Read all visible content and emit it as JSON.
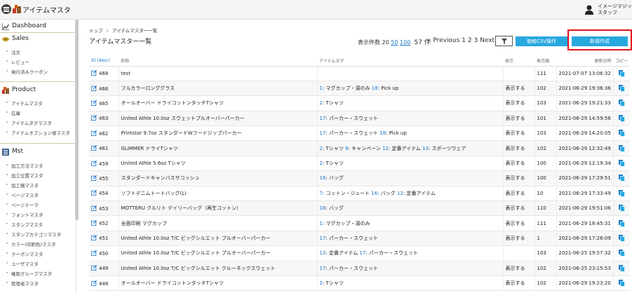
{
  "header": {
    "title": "アイテムマスタ",
    "user_line1": "イメージマジック",
    "user_line2": "スタッフ"
  },
  "sidebar": {
    "dashboard": "Dashboard",
    "sales": "Sales",
    "sales_items": [
      "注文",
      "レビュー",
      "発行済みクーポン"
    ],
    "product": "Product",
    "product_items": [
      "アイテムマスタ",
      "在庫",
      "アイテムタグマスタ",
      "アイテムオプション値マスタ"
    ],
    "mst": "Mst",
    "mst_items": [
      "加工方法マスタ",
      "加工位置マスタ",
      "加工機マスタ",
      "ページマスタ",
      "ページテーマ",
      "フォントマスタ",
      "スタンプマスタ",
      "スタンプカテゴリマスタ",
      "カラー(印刷色)マスタ",
      "クーポンマスタ",
      "ユーザマスタ",
      "権限グループマスタ",
      "管理者マスタ"
    ]
  },
  "breadcrumb": {
    "top": "トップ",
    "sep": ">",
    "current": "アイテムマスター一覧"
  },
  "page_title": "アイテムマスター一覧",
  "pager": {
    "label": "表示件数",
    "opt1": "20",
    "opt2": "50",
    "opt3": "100",
    "total": "57 件",
    "prev": "« Previous",
    "pages": [
      "1",
      "2",
      "3"
    ],
    "next": "Next »"
  },
  "buttons": {
    "csv": "価格CSV操作",
    "new": "新規作成"
  },
  "columns": {
    "id": "ID (desc)",
    "name": "名称",
    "tags": "アイテムタグ",
    "display": "表示",
    "order": "表示順",
    "updated": "更新日時",
    "copy": "コピー"
  },
  "rows": [
    {
      "id": "468",
      "name": "test",
      "tags": "",
      "display": "",
      "order": "111",
      "updated": "2021-07-07 13:06:32"
    },
    {
      "id": "466",
      "name": "フルカラーロンググラス",
      "tags": "1: マグカップ・湯のみ 18: Pick up",
      "display": "表示する",
      "order": "102",
      "updated": "2021-06-29 19:36:36"
    },
    {
      "id": "465",
      "name": "オールオーバー ドライコットンタッチTシャツ",
      "tags": "2: Tシャツ",
      "display": "表示する",
      "order": "103",
      "updated": "2021-06-29 19:21:33"
    },
    {
      "id": "463",
      "name": "United Athle 10.0oz スウェットプルオーバーパーカー",
      "tags": "17: パーカー・スウェット",
      "display": "表示する",
      "order": "101",
      "updated": "2021-06-29 14:59:56"
    },
    {
      "id": "462",
      "name": "Printstar 9.7oz スタンダードWフードジップパーカー",
      "tags": "17: パーカー・スウェット 18: Pick up",
      "display": "表示する",
      "order": "103",
      "updated": "2021-06-29 14:20:05"
    },
    {
      "id": "461",
      "name": "GLIMMER ドライTシャツ",
      "tags": "2: Tシャツ 8: キャンペーン 12: 定番アイテム 13: スポーツウェア",
      "display": "表示する",
      "order": "102",
      "updated": "2021-06-29 12:32:49"
    },
    {
      "id": "459",
      "name": "United Athle 5.6oz Tシャツ",
      "tags": "2: Tシャツ",
      "display": "表示する",
      "order": "100",
      "updated": "2021-06-29 12:19:34"
    },
    {
      "id": "455",
      "name": "スタンダードキャンバスサコッシュ",
      "tags": "16: バッグ",
      "display": "表示する",
      "order": "100",
      "updated": "2021-06-29 17:29:51"
    },
    {
      "id": "454",
      "name": "ソフトデニムトートバッグ(L)",
      "tags": "7: コットン・ジュート 16: バッグ 12: 定番アイテム",
      "display": "表示する",
      "order": "10",
      "updated": "2021-06-29 17:33:49"
    },
    {
      "id": "453",
      "name": "MOTTERU クルリト デイリーバッグ（再生コットン）",
      "tags": "16: バッグ",
      "display": "表示する",
      "order": "110",
      "updated": "2021-06-29 19:51:06"
    },
    {
      "id": "452",
      "name": "全面印刷 マグカップ",
      "tags": "1: マグカップ・湯のみ",
      "display": "表示する",
      "order": "111",
      "updated": "2021-06-29 18:45:31"
    },
    {
      "id": "451",
      "name": "United Athle 10.0oz T/C ビッグシルエット プルオーバーパーカー",
      "tags": "17: パーカー・スウェット",
      "display": "表示する",
      "order": "1",
      "updated": "2021-06-29 17:26:09"
    },
    {
      "id": "450",
      "name": "United Athle 10.0oz T/C ビッグシルエット プルオーバーパーカー",
      "tags": "12: 定番アイテム 17: パーカー・スウェット",
      "display": "",
      "order": "103",
      "updated": "2021-06-25 19:57:32"
    },
    {
      "id": "449",
      "name": "United Athle 10.0oz T/C ビッグシルエット クルーネックスウェット",
      "tags": "17: パーカー・スウェット",
      "display": "表示する",
      "order": "102",
      "updated": "2021-06-25 23:15:53"
    },
    {
      "id": "448",
      "name": "オールオーバー ドライコットンタッチTシャツ",
      "tags": "2: Tシャツ",
      "display": "表示する",
      "order": "102",
      "updated": "2021-06-29 19:23:20"
    }
  ],
  "colors": {
    "accent": "#29a8e0",
    "link": "#1a73c8",
    "highlight": "#e0141e"
  }
}
